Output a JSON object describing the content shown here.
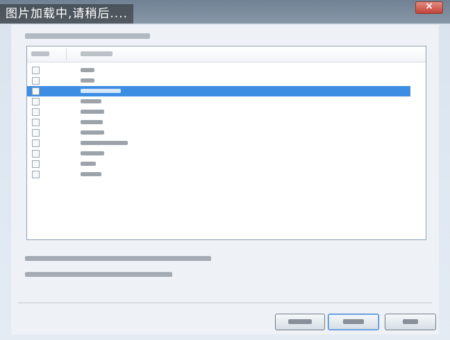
{
  "overlay": {
    "loading_text": "图片加载中,请稍后...."
  },
  "window": {
    "close_glyph": "×"
  },
  "list": {
    "row_count": 11,
    "selected_index": 2
  },
  "buttons": {
    "count": 3,
    "default_index": 1
  },
  "colors": {
    "selection": "#3d8ee2",
    "titlebar": "#7d8d9e",
    "close": "#c1433a"
  }
}
